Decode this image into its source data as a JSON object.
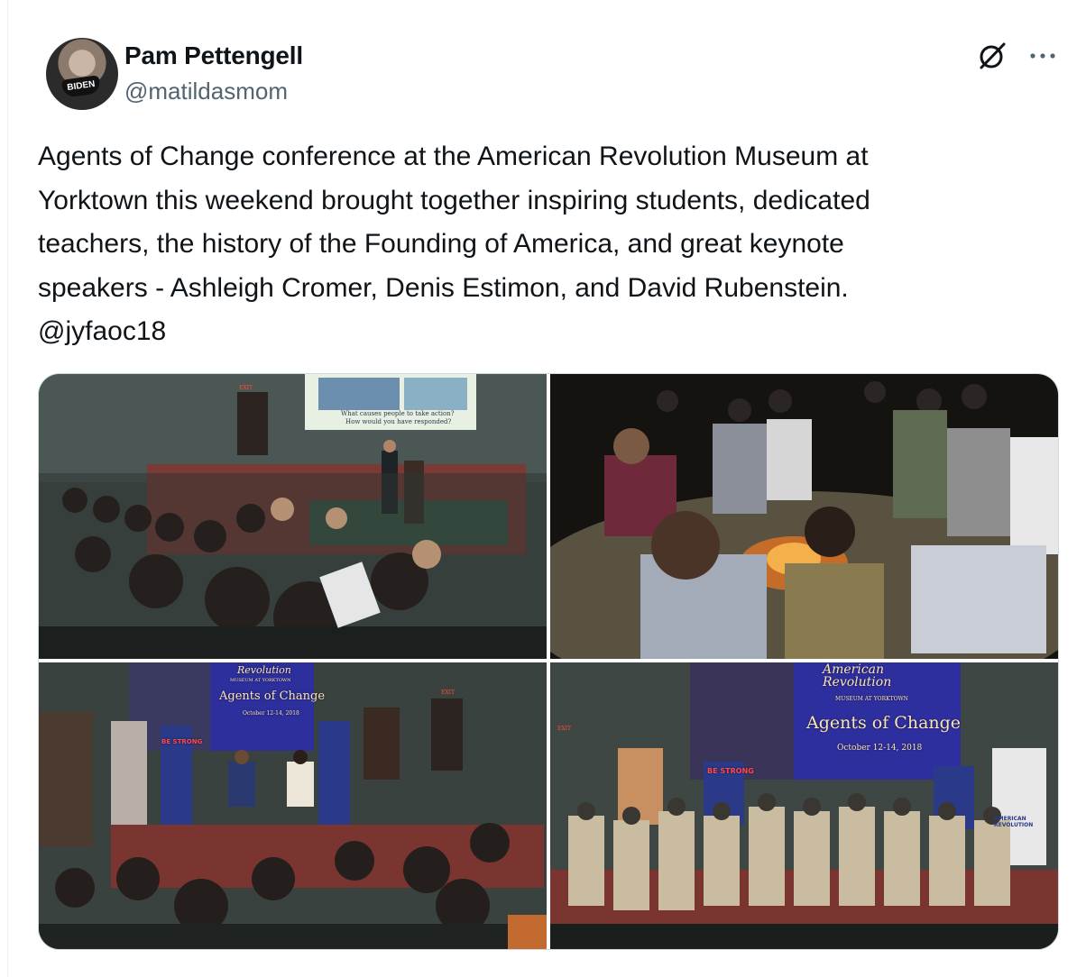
{
  "tweet": {
    "author": {
      "name": "Pam Pettengell",
      "handle": "@matildasmom",
      "avatar_mask_text": "BIDEN"
    },
    "text": "Agents of Change conference at the American Revolution Museum at\nYorktown this weekend brought together inspiring students, dedicated\nteachers, the history of the Founding of America, and great keynote\nspeakers - Ashleigh Cromer, Denis Estimon, and David Rubenstein.\n@jyfaoc18",
    "icons": {
      "grok": "grok-icon",
      "more": "more-icon"
    }
  },
  "media": {
    "photos": [
      {
        "id": "photo-1",
        "slide_line1": "What causes people to take action?",
        "slide_line2": "How would you have responded?",
        "exit_sign": "EXIT"
      },
      {
        "id": "photo-2"
      },
      {
        "id": "photo-3",
        "screen_brand": "Revolution",
        "screen_sub": "MUSEUM AT YORKTOWN",
        "screen_title": "Agents of Change",
        "screen_date": "October 12-14, 2018",
        "banner_text": "BE STRONG",
        "exit_sign": "EXIT"
      },
      {
        "id": "photo-4",
        "screen_brand_1": "American",
        "screen_brand_2": "Revolution",
        "screen_sub": "MUSEUM AT YORKTOWN",
        "screen_title": "Agents of Change",
        "screen_date": "October 12-14, 2018",
        "banner_text": "BE STRONG",
        "side_banner": "AMERICAN REVOLUTION",
        "exit_sign": "EXIT"
      }
    ]
  },
  "colors": {
    "text": "#0f1419",
    "secondary": "#536471",
    "border": "#cfd9de"
  }
}
